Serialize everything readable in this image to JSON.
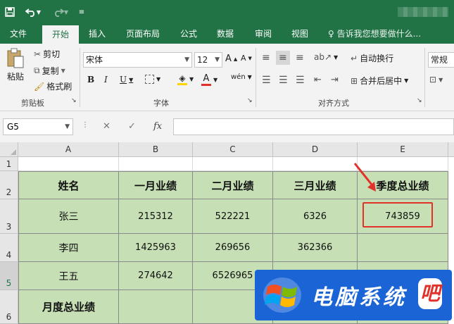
{
  "ribbon_tabs": [
    "文件",
    "开始",
    "插入",
    "页面布局",
    "公式",
    "数据",
    "审阅",
    "视图"
  ],
  "tell_me": "告诉我您想要做什么...",
  "clipboard": {
    "paste": "粘贴",
    "cut": "剪切",
    "copy": "复制",
    "format_painter": "格式刷",
    "group": "剪贴板"
  },
  "font": {
    "name": "宋体",
    "size": "12",
    "group": "字体"
  },
  "alignment": {
    "wrap": "自动换行",
    "merge": "合并后居中",
    "group": "对齐方式"
  },
  "number": {
    "format": "常规"
  },
  "name_box": "G5",
  "fx_label": "fx",
  "columns": [
    "A",
    "B",
    "C",
    "D",
    "E"
  ],
  "rows": [
    "1",
    "2",
    "3",
    "4",
    "5",
    "6"
  ],
  "table": {
    "header": [
      "姓名",
      "一月业绩",
      "二月业绩",
      "三月业绩",
      "季度总业绩"
    ],
    "data": [
      [
        "张三",
        "215312",
        "522221",
        "6326",
        "743859"
      ],
      [
        "李四",
        "1425963",
        "269656",
        "362366",
        ""
      ],
      [
        "王五",
        "274642",
        "6526965",
        "",
        ""
      ]
    ],
    "footer": [
      "月度总业绩",
      "",
      "",
      "",
      ""
    ]
  },
  "watermark": {
    "text": "电脑系统",
    "last_char": "吧"
  },
  "colors": {
    "excel_green": "#217346",
    "cell_green": "#c6dfb4",
    "highlight_red": "#e0322a"
  }
}
